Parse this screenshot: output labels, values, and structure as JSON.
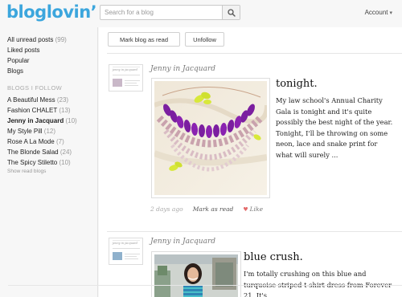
{
  "header": {
    "logo": "bloglovin’",
    "search_placeholder": "Search for a blog",
    "account_label": "Account",
    "account_caret": "▾"
  },
  "sidebar": {
    "top_links": [
      {
        "label": "All unread posts",
        "count": "(99)"
      },
      {
        "label": "Liked posts",
        "count": ""
      },
      {
        "label": "Popular",
        "count": ""
      },
      {
        "label": "Blogs",
        "count": ""
      }
    ],
    "heading": "BLOGS I FOLLOW",
    "blogs": [
      {
        "label": "A Beautiful Mess",
        "count": "(23)",
        "active": false
      },
      {
        "label": "Fashion CHALET",
        "count": "(13)",
        "active": false
      },
      {
        "label": "Jenny in Jacquard",
        "count": "(10)",
        "active": true
      },
      {
        "label": "My Style Pill",
        "count": "(12)",
        "active": false
      },
      {
        "label": "Rose A La Mode",
        "count": "(7)",
        "active": false
      },
      {
        "label": "The Blonde Salad",
        "count": "(24)",
        "active": false
      },
      {
        "label": "The Spicy Stiletto",
        "count": "(10)",
        "active": false
      }
    ],
    "show_read": "Show read blogs"
  },
  "toolbar": {
    "mark_read_label": "Mark blog as read",
    "unfollow_label": "Unfollow"
  },
  "posts": [
    {
      "author": "Jenny in Jacquard",
      "title": "tonight.",
      "excerpt": "My law school's Annual Charity Gala is tonight and it's quite possibly the best night of the year. Tonight, I'll be throwing on some neon, lace and snake print for what will surely ...",
      "time_ago": "2 days ago",
      "mark_label": "Mark as read",
      "like_label": "Like"
    },
    {
      "author": "Jenny in Jacquard",
      "title": "blue crush.",
      "excerpt": "I'm totally crushing on this blue and turquoise striped t-shirt dress from Forever 21.  It's"
    }
  ],
  "colors": {
    "brand": "#3ca6dd",
    "like_heart": "#e36a6a",
    "necklace_purple": "#7b1ea0",
    "neon_yellow": "#d8e83a"
  }
}
